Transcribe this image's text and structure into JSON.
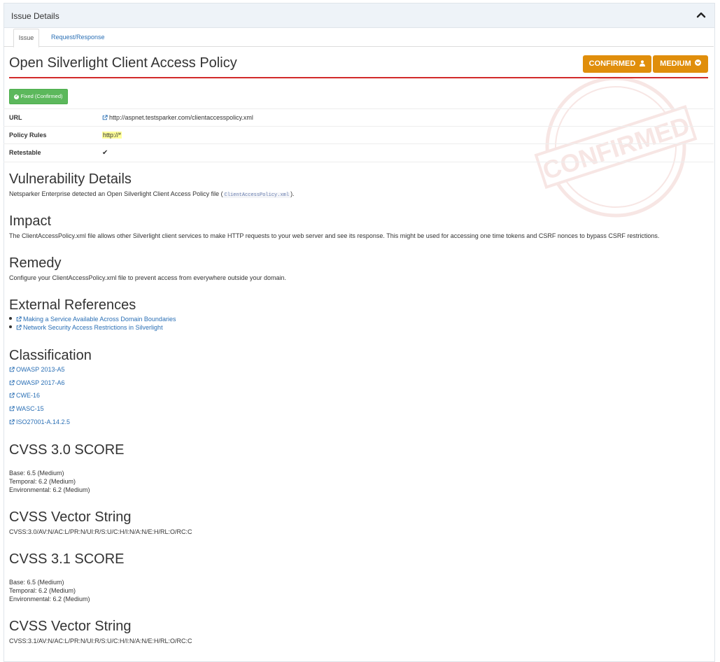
{
  "panel": {
    "title": "Issue Details",
    "collapse_icon": "chevron-up-icon"
  },
  "tabs": [
    {
      "label": "Issue",
      "active": true
    },
    {
      "label": "Request/Response",
      "active": false
    }
  ],
  "issue": {
    "title": "Open Silverlight Client Access Policy",
    "badges": {
      "confirmed": "CONFIRMED",
      "confirmed_icon": "user-icon",
      "severity": "MEDIUM",
      "severity_icon": "chevron-circle-down-icon"
    },
    "status": "Fixed (Confirmed)",
    "stamp_text": "CONFIRMED",
    "colors": {
      "accent": "#e08e0b",
      "rule": "#d22a2a",
      "status": "#5cb85c",
      "link": "#2a6fb5"
    }
  },
  "details": [
    {
      "key": "URL",
      "value": "http://aspnet.testsparker.com/clientaccesspolicy.xml",
      "type": "link"
    },
    {
      "key": "Policy Rules",
      "value": "http://*",
      "type": "highlight"
    },
    {
      "key": "Retestable",
      "value": "✔",
      "type": "check"
    }
  ],
  "vulnerability": {
    "heading": "Vulnerability Details",
    "text_before": "Netsparker Enterprise detected an Open Silverlight Client Access Policy file (",
    "code": "ClientAccessPolicy.xml",
    "text_after": ")."
  },
  "impact": {
    "heading": "Impact",
    "text": "The ClientAccessPolicy.xml file allows other Silverlight client services to make HTTP requests to your web server and see its response. This might be used for accessing one time tokens and CSRF nonces to bypass CSRF restrictions."
  },
  "remedy": {
    "heading": "Remedy",
    "text": "Configure your ClientAccessPolicy.xml file to prevent access from everywhere outside your domain."
  },
  "references": {
    "heading": "External References",
    "items": [
      "Making a Service Available Across Domain Boundaries",
      "Network Security Access Restrictions in Silverlight"
    ]
  },
  "classification": {
    "heading": "Classification",
    "items": [
      "OWASP 2013-A5",
      "OWASP 2017-A6",
      "CWE-16",
      "WASC-15",
      "ISO27001-A.14.2.5"
    ]
  },
  "cvss30": {
    "heading": "CVSS 3.0 SCORE",
    "base": "Base: 6.5 (Medium)",
    "temporal": "Temporal: 6.2 (Medium)",
    "environmental": "Environmental: 6.2 (Medium)"
  },
  "vector30": {
    "heading": "CVSS Vector String",
    "value": "CVSS:3.0/AV:N/AC:L/PR:N/UI:R/S:U/C:H/I:N/A:N/E:H/RL:O/RC:C"
  },
  "cvss31": {
    "heading": "CVSS 3.1 SCORE",
    "base": "Base: 6.5 (Medium)",
    "temporal": "Temporal: 6.2 (Medium)",
    "environmental": "Environmental: 6.2 (Medium)"
  },
  "vector31": {
    "heading": "CVSS Vector String",
    "value": "CVSS:3.1/AV:N/AC:L/PR:N/UI:R/S:U/C:H/I:N/A:N/E:H/RL:O/RC:C"
  }
}
